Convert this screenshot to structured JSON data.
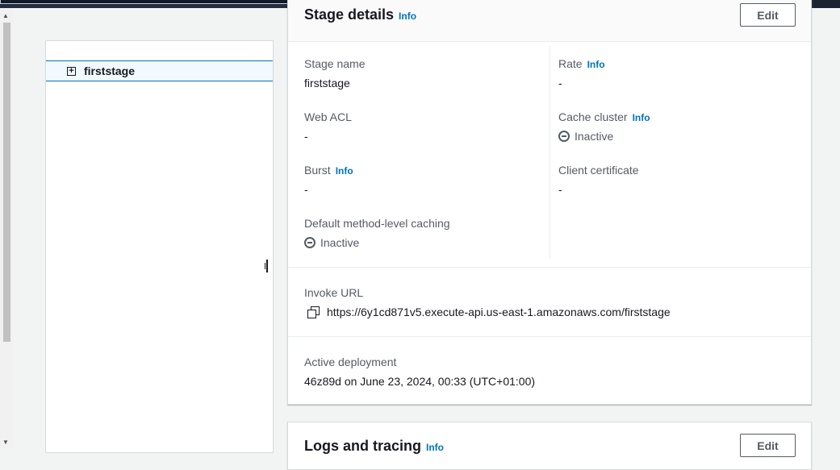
{
  "stages": {
    "items": [
      {
        "name": "firststage",
        "expand_symbol": "+"
      }
    ]
  },
  "stage_details": {
    "title": "Stage details",
    "info_label": "Info",
    "edit_label": "Edit",
    "fields": {
      "stage_name": {
        "label": "Stage name",
        "value": "firststage"
      },
      "web_acl": {
        "label": "Web ACL",
        "value": "-"
      },
      "burst": {
        "label": "Burst",
        "info": "Info",
        "value": "-"
      },
      "default_caching": {
        "label": "Default method-level caching",
        "value": "Inactive"
      },
      "rate": {
        "label": "Rate",
        "info": "Info",
        "value": "-"
      },
      "cache_cluster": {
        "label": "Cache cluster",
        "info": "Info",
        "value": "Inactive"
      },
      "client_certificate": {
        "label": "Client certificate",
        "value": "-"
      }
    },
    "invoke_url": {
      "label": "Invoke URL",
      "value": "https://6y1cd871v5.execute-api.us-east-1.amazonaws.com/firststage",
      "icon": "copy-icon"
    },
    "active_deployment": {
      "label": "Active deployment",
      "value": "46z89d on June 23, 2024, 00:33 (UTC+01:00)"
    }
  },
  "logs_tracing": {
    "title": "Logs and tracing",
    "info_label": "Info",
    "edit_label": "Edit"
  },
  "colors": {
    "link": "#0073bb",
    "selected_border": "#0073bb",
    "selected_bg": "#f1faff",
    "topbar": "#232f3e"
  }
}
